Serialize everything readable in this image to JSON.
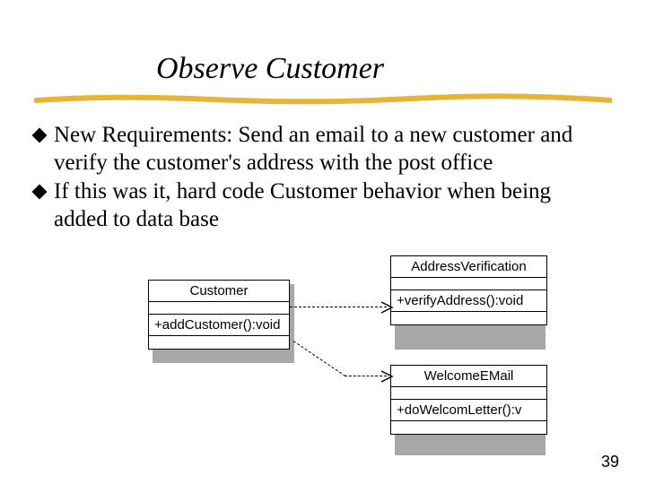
{
  "title": "Observe Customer",
  "bullets": [
    "New Requirements: Send an email to a new customer and verify the customer's address with the post office",
    "If this was it, hard code Customer behavior when being added to data base"
  ],
  "uml": {
    "customer": {
      "name": "Customer",
      "method": "+addCustomer():void"
    },
    "addressVerification": {
      "name": "AddressVerification",
      "method": "+verifyAddress():void"
    },
    "welcomeEmail": {
      "name": "WelcomeEMail",
      "method": "+doWelcomLetter():v"
    }
  },
  "pageNumber": "39"
}
